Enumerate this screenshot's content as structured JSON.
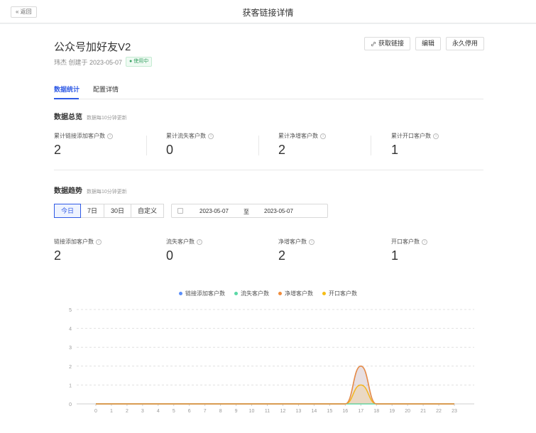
{
  "topbar": {
    "back_label": "« 返回",
    "title": "获客链接详情"
  },
  "header": {
    "title": "公众号加好友V2",
    "meta": "玮杰 创建于 2023-05-07",
    "status": "使用中",
    "status_color": "#3aa365",
    "actions": {
      "get_link": "获取链接",
      "get_link_icon": "link-icon",
      "edit": "编辑",
      "disable": "永久停用"
    }
  },
  "tabs": [
    {
      "label": "数据统计",
      "active": true
    },
    {
      "label": "配置详情",
      "active": false
    }
  ],
  "overview": {
    "title": "数据总览",
    "note": "数据每10分钟更新",
    "stats": [
      {
        "label": "累计链接添加客户数",
        "value": "2"
      },
      {
        "label": "累计流失客户数",
        "value": "0"
      },
      {
        "label": "累计净增客户数",
        "value": "2"
      },
      {
        "label": "累计开口客户数",
        "value": "1"
      }
    ]
  },
  "trend": {
    "title": "数据趋势",
    "note": "数据每10分钟更新",
    "ranges": [
      "今日",
      "7日",
      "30日",
      "自定义"
    ],
    "selected_range": "今日",
    "date_start": "2023-05-07",
    "date_sep": "至",
    "date_end": "2023-05-07",
    "stats": [
      {
        "label": "链接添加客户数",
        "value": "2"
      },
      {
        "label": "流失客户数",
        "value": "0"
      },
      {
        "label": "净增客户数",
        "value": "2"
      },
      {
        "label": "开口客户数",
        "value": "1"
      }
    ]
  },
  "accent_color": "#2f5ae5",
  "chart_data": {
    "type": "area",
    "x": [
      0,
      1,
      2,
      3,
      4,
      5,
      6,
      7,
      8,
      9,
      10,
      11,
      12,
      13,
      14,
      15,
      16,
      17,
      18,
      19,
      20,
      21,
      22,
      23
    ],
    "ylim": [
      0,
      5
    ],
    "yticks": [
      0,
      1,
      2,
      3,
      4,
      5
    ],
    "grid": true,
    "legend_position": "top-center",
    "series": [
      {
        "name": "链接添加客户数",
        "color": "#5b8ff9",
        "values": [
          0,
          0,
          0,
          0,
          0,
          0,
          0,
          0,
          0,
          0,
          0,
          0,
          0,
          0,
          0,
          0,
          0,
          2,
          0,
          0,
          0,
          0,
          0,
          0
        ]
      },
      {
        "name": "流失客户数",
        "color": "#5ad8a6",
        "values": [
          0,
          0,
          0,
          0,
          0,
          0,
          0,
          0,
          0,
          0,
          0,
          0,
          0,
          0,
          0,
          0,
          0,
          0,
          0,
          0,
          0,
          0,
          0,
          0
        ]
      },
      {
        "name": "净增客户数",
        "color": "#f08c3c",
        "values": [
          0,
          0,
          0,
          0,
          0,
          0,
          0,
          0,
          0,
          0,
          0,
          0,
          0,
          0,
          0,
          0,
          0,
          2,
          0,
          0,
          0,
          0,
          0,
          0
        ]
      },
      {
        "name": "开口客户数",
        "color": "#f6bd16",
        "values": [
          0,
          0,
          0,
          0,
          0,
          0,
          0,
          0,
          0,
          0,
          0,
          0,
          0,
          0,
          0,
          0,
          0,
          1,
          0,
          0,
          0,
          0,
          0,
          0
        ]
      }
    ]
  }
}
